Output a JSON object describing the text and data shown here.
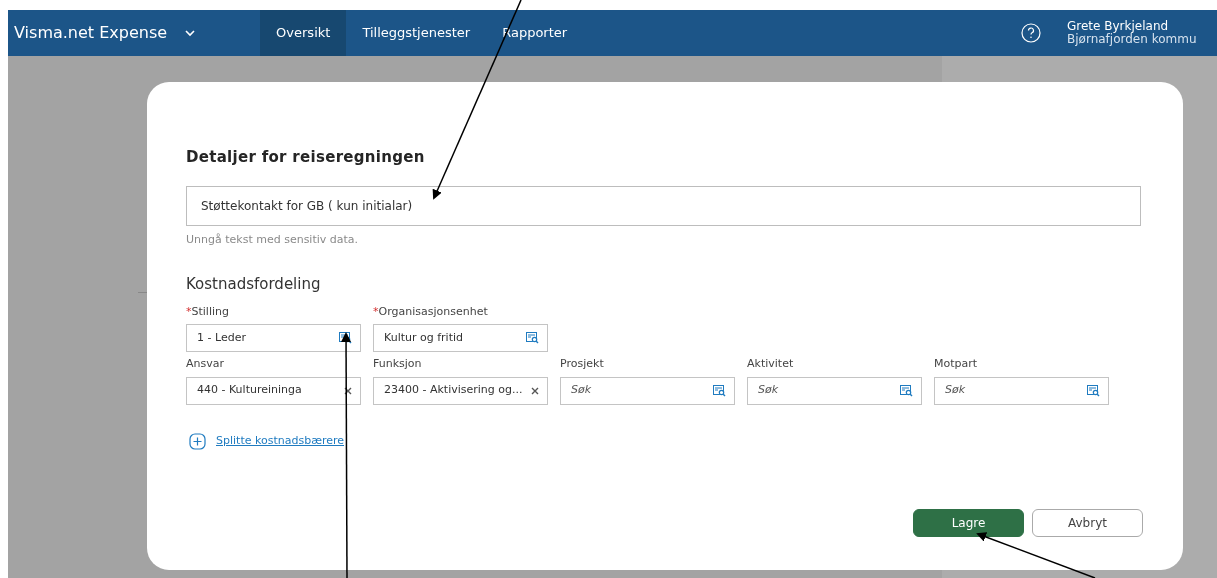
{
  "topbar": {
    "app_title": "Visma.net Expense",
    "tabs": [
      {
        "label": "Oversikt",
        "selected": true
      },
      {
        "label": "Tilleggstjenester",
        "selected": false
      },
      {
        "label": "Rapporter",
        "selected": false
      }
    ],
    "user": {
      "name": "Grete Byrkjeland",
      "organisation": "Bjørnafjorden kommu"
    }
  },
  "dialog": {
    "title": "Detaljer for reiseregningen",
    "description": {
      "value": "Støttekontakt for GB ( kun initialar)",
      "hint": "Unngå tekst med sensitiv data."
    },
    "section_title": "Kostnadsfordeling",
    "field_rows": [
      [
        {
          "label": "Stilling",
          "required_mark": "*",
          "value": "1 - Leder",
          "kind": "lookup"
        },
        {
          "label": "Organisasjonsenhet",
          "required_mark": "*",
          "value": "Kultur og fritid",
          "kind": "lookup"
        }
      ],
      [
        {
          "label": "Ansvar",
          "value": "440 - Kultureininga",
          "kind": "clear"
        },
        {
          "label": "Funksjon",
          "value": "23400 - Aktivisering og...",
          "kind": "clear"
        },
        {
          "label": "Prosjekt",
          "placeholder": "Søk",
          "kind": "lookup"
        },
        {
          "label": "Aktivitet",
          "placeholder": "Søk",
          "kind": "lookup"
        },
        {
          "label": "Motpart",
          "placeholder": "Søk",
          "kind": "lookup"
        }
      ]
    ],
    "split_link": "Splitte kostnadsbærere",
    "buttons": [
      {
        "label": "Lagre",
        "kind": "primary"
      },
      {
        "label": "Avbryt",
        "kind": "secondary"
      }
    ]
  }
}
